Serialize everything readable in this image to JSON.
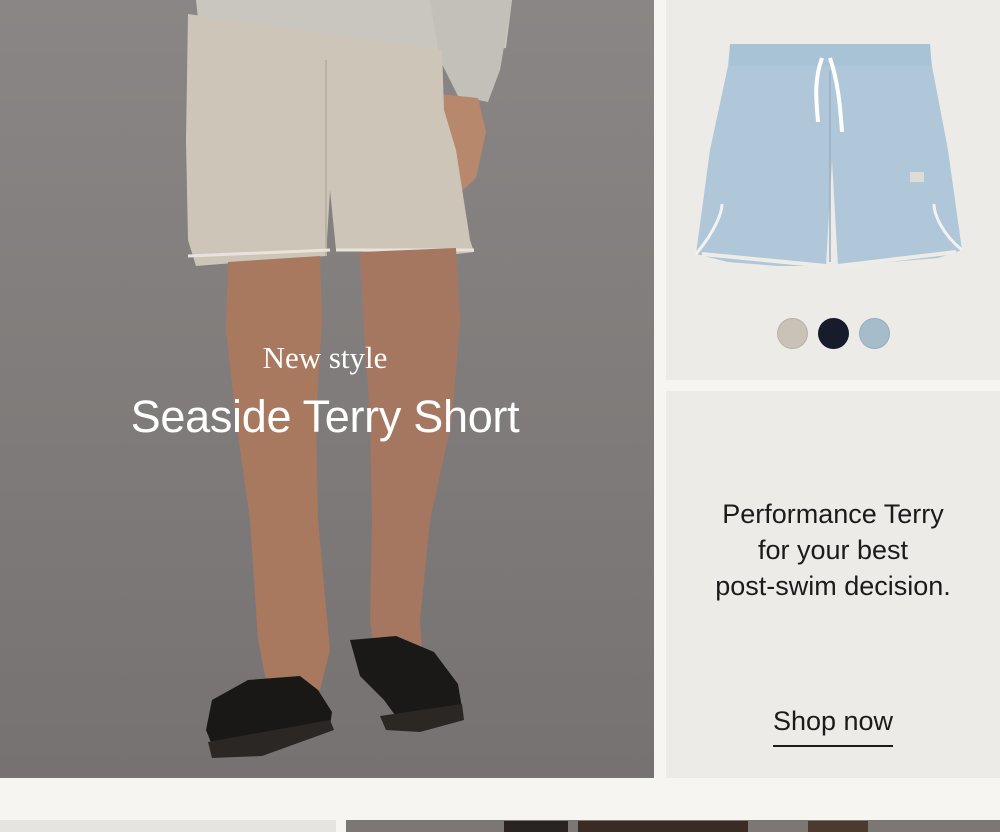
{
  "hero": {
    "eyebrow": "New style",
    "title": "Seaside Terry Short"
  },
  "product": {
    "swatches": [
      {
        "name": "Sand",
        "color": "#c9c2b6"
      },
      {
        "name": "Navy",
        "color": "#161c2c"
      },
      {
        "name": "Light Blue",
        "color": "#a5bccb"
      }
    ]
  },
  "promo": {
    "lines": [
      "Performance Terry",
      "for your best",
      "post-swim decision."
    ],
    "cta_label": "Shop now"
  }
}
